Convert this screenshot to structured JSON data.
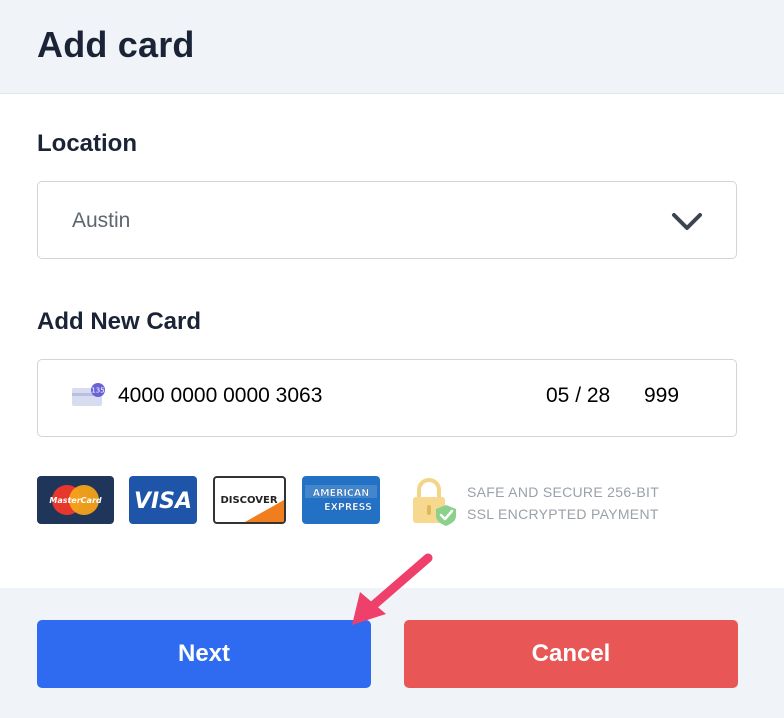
{
  "dialog": {
    "title": "Add card"
  },
  "location": {
    "label": "Location",
    "selected": "Austin"
  },
  "new_card": {
    "label": "Add New Card",
    "card_badge": "135",
    "number": "4000 0000 0000 3063",
    "expiry": "05 / 28",
    "cvc": "999"
  },
  "brands": {
    "mastercard": "MasterCard",
    "visa": "VISA",
    "discover": "DISCOVER",
    "amex_line1": "AMERICAN",
    "amex_line2": "EXPRESS"
  },
  "security": {
    "line1": "SAFE AND SECURE 256-BIT",
    "line2": "SSL ENCRYPTED PAYMENT"
  },
  "buttons": {
    "next": "Next",
    "cancel": "Cancel"
  },
  "colors": {
    "primary": "#2e6bf0",
    "danger": "#e95656",
    "annotation_arrow": "#ef3f6b"
  }
}
